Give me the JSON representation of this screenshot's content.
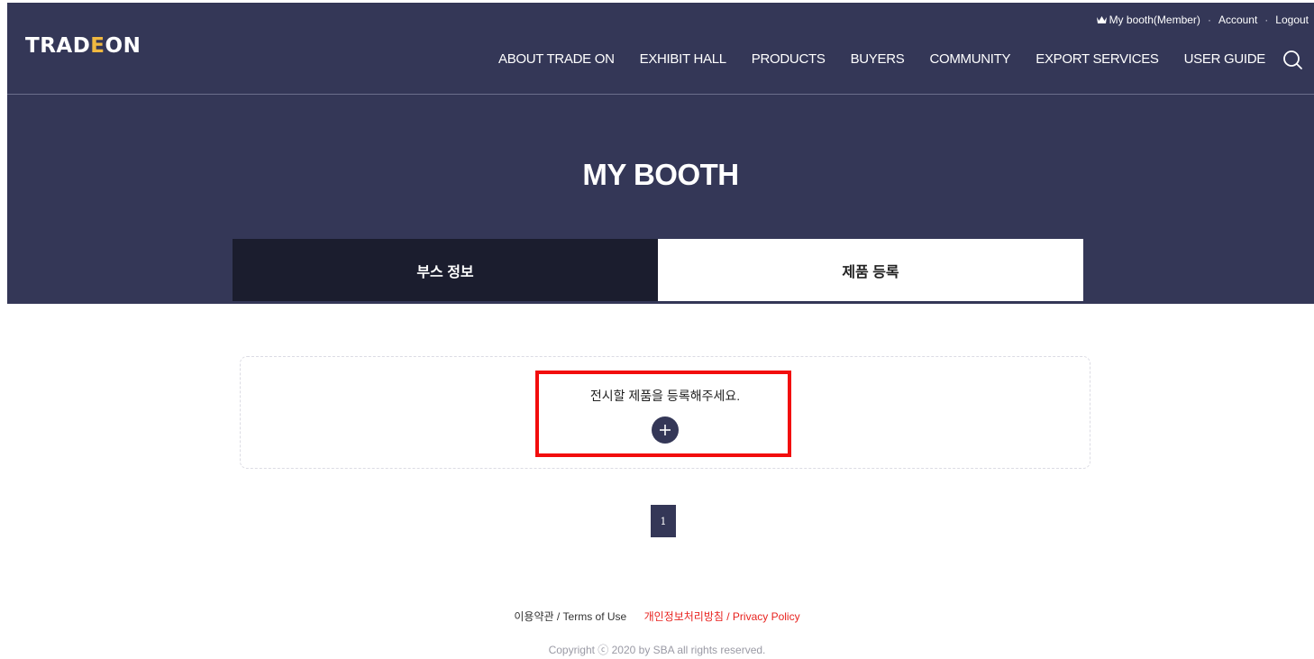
{
  "brand": {
    "logo_left": "TRAD",
    "logo_mark": "E",
    "logo_right": "ON"
  },
  "utility_nav": {
    "my_booth": "My booth(Member)",
    "separator": "·",
    "account": "Account",
    "logout": "Logout"
  },
  "main_nav": [
    "ABOUT TRADE ON",
    "EXHIBIT HALL",
    "PRODUCTS",
    "BUYERS",
    "COMMUNITY",
    "EXPORT SERVICES",
    "USER GUIDE"
  ],
  "page": {
    "title": "MY BOOTH"
  },
  "tabs": [
    {
      "label": "부스 정보",
      "active": false
    },
    {
      "label": "제품 등록",
      "active": true
    }
  ],
  "products": {
    "empty_message": "전시할 제품을 등록해주세요."
  },
  "pagination": {
    "current": "1"
  },
  "footer": {
    "terms": "이용약관 / Terms of Use",
    "privacy": "개인정보처리방침 / Privacy Policy",
    "copyright": "Copyright ⓒ 2020 by SBA all rights reserved."
  },
  "colors": {
    "header_bg": "#343757",
    "tab_dark": "#1b1d2e",
    "accent": "#f0b840",
    "highlight": "#f20d0d",
    "privacy_link": "#e8231f"
  }
}
